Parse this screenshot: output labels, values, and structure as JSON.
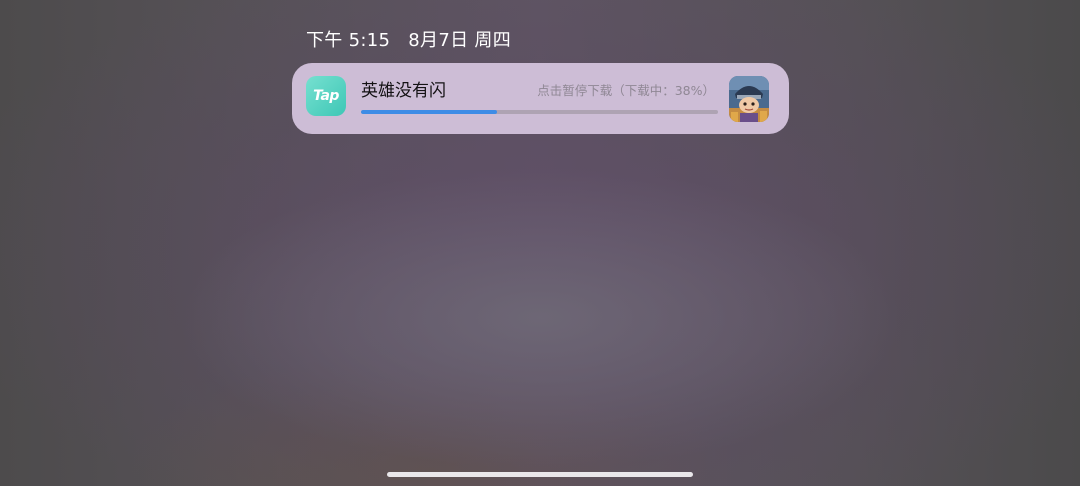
{
  "status_bar": {
    "time": "下午 5:15",
    "date": "8月7日",
    "weekday": "周四"
  },
  "notification": {
    "app_icon": "taptap-logo",
    "app_icon_text": "Tap",
    "title": "英雄没有闪",
    "status": "点击暂停下载（下载中：38%）",
    "progress": 0.38,
    "thumbnail": "game-icon",
    "colors": {
      "card_bg": "#cdbdd6",
      "progress_fill": "#3e8ce6",
      "progress_track": "#aea3b3",
      "app_icon_bg": "#4fd1c0"
    }
  },
  "home_indicator": "home-bar"
}
